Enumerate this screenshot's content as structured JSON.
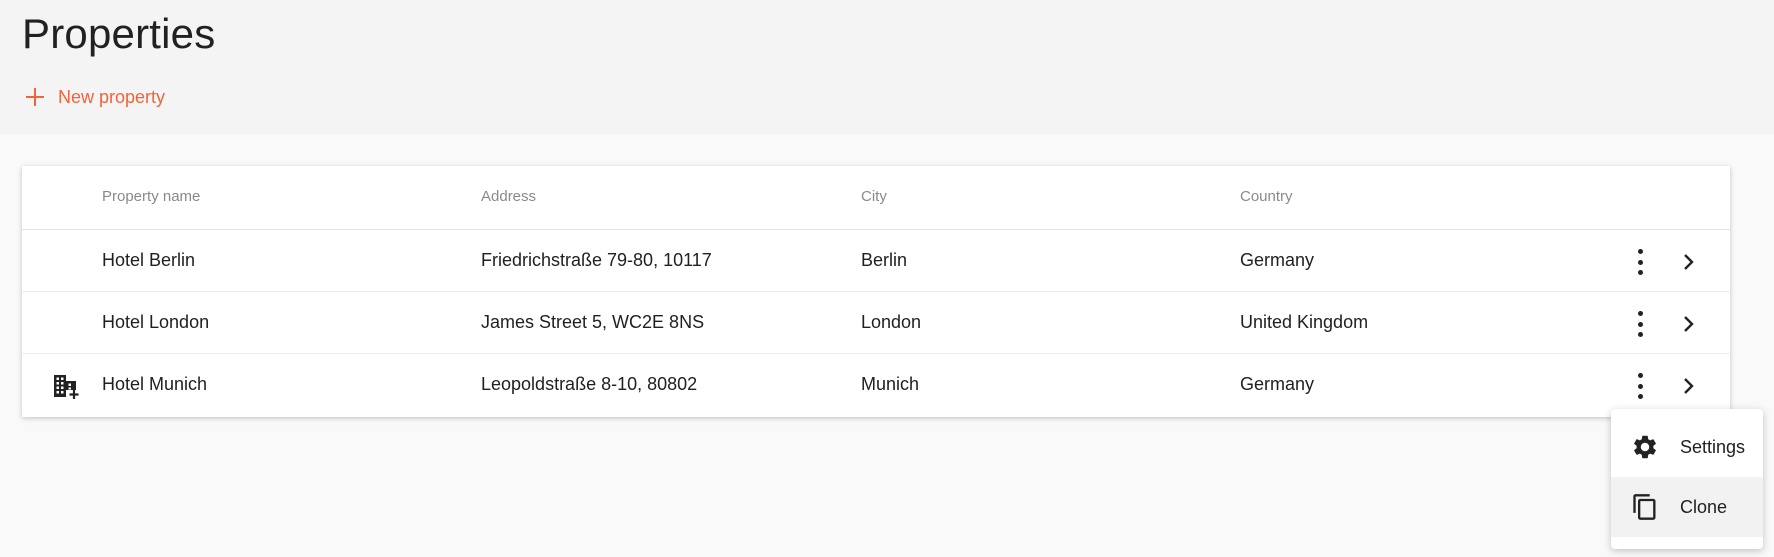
{
  "header": {
    "title": "Properties",
    "new_label": "New property"
  },
  "table": {
    "columns": [
      "Property name",
      "Address",
      "City",
      "Country"
    ],
    "rows": [
      {
        "name": "Hotel Berlin",
        "address": "Friedrichstraße 79-80, 10117",
        "city": "Berlin",
        "country": "Germany",
        "icon": ""
      },
      {
        "name": "Hotel London",
        "address": "James Street 5, WC2E 8NS",
        "city": "London",
        "country": "United Kingdom",
        "icon": ""
      },
      {
        "name": "Hotel Munich",
        "address": "Leopoldstraße 8-10, 80802",
        "city": "Munich",
        "country": "Germany",
        "icon": "domain-add-icon"
      }
    ]
  },
  "context_menu": {
    "items": [
      {
        "label": "Settings",
        "icon": "gear-icon"
      },
      {
        "label": "Clone",
        "icon": "copy-icon"
      }
    ]
  },
  "colors": {
    "accent": "#f0643c",
    "header_bg": "#f4f4f4",
    "page_bg": "#f9f9f9"
  }
}
